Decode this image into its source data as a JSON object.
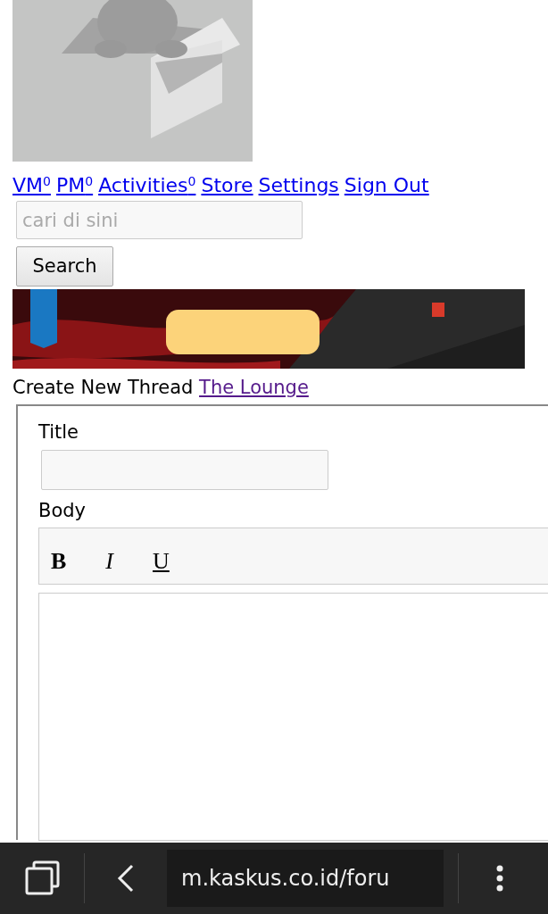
{
  "user_links": [
    {
      "label": "VM$^{0}$"
    },
    {
      "label": "PM$^{0}$"
    },
    {
      "label": "Activities$^{0}$"
    },
    {
      "label": "Store"
    },
    {
      "label": "Settings"
    },
    {
      "label": "Sign Out"
    }
  ],
  "search": {
    "placeholder": "cari di sini",
    "button": "Search"
  },
  "heading": {
    "text": "Create New Thread",
    "forum_link": "The Lounge"
  },
  "form": {
    "title_label": "Title",
    "body_label": "Body",
    "toolbar": [
      {
        "label": "B",
        "kind": "bold"
      },
      {
        "label": "I",
        "kind": "italic"
      },
      {
        "label": "U",
        "kind": "underline"
      }
    ]
  },
  "browser_bar": {
    "url": "m.kaskus.co.id/foru"
  }
}
